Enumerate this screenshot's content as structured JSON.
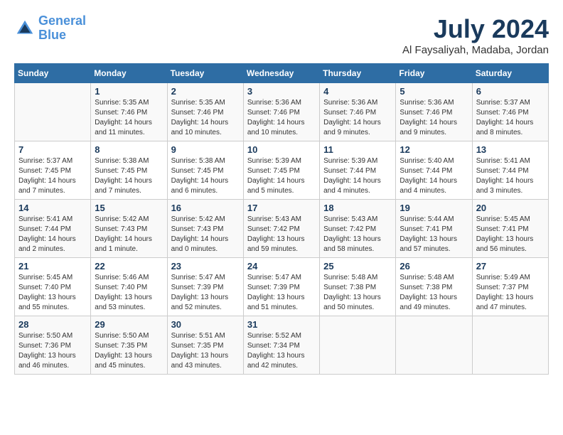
{
  "header": {
    "logo_line1": "General",
    "logo_line2": "Blue",
    "month_title": "July 2024",
    "location": "Al Faysaliyah, Madaba, Jordan"
  },
  "days_of_week": [
    "Sunday",
    "Monday",
    "Tuesday",
    "Wednesday",
    "Thursday",
    "Friday",
    "Saturday"
  ],
  "weeks": [
    [
      {
        "day": "",
        "info": ""
      },
      {
        "day": "1",
        "info": "Sunrise: 5:35 AM\nSunset: 7:46 PM\nDaylight: 14 hours\nand 11 minutes."
      },
      {
        "day": "2",
        "info": "Sunrise: 5:35 AM\nSunset: 7:46 PM\nDaylight: 14 hours\nand 10 minutes."
      },
      {
        "day": "3",
        "info": "Sunrise: 5:36 AM\nSunset: 7:46 PM\nDaylight: 14 hours\nand 10 minutes."
      },
      {
        "day": "4",
        "info": "Sunrise: 5:36 AM\nSunset: 7:46 PM\nDaylight: 14 hours\nand 9 minutes."
      },
      {
        "day": "5",
        "info": "Sunrise: 5:36 AM\nSunset: 7:46 PM\nDaylight: 14 hours\nand 9 minutes."
      },
      {
        "day": "6",
        "info": "Sunrise: 5:37 AM\nSunset: 7:46 PM\nDaylight: 14 hours\nand 8 minutes."
      }
    ],
    [
      {
        "day": "7",
        "info": "Sunrise: 5:37 AM\nSunset: 7:45 PM\nDaylight: 14 hours\nand 7 minutes."
      },
      {
        "day": "8",
        "info": "Sunrise: 5:38 AM\nSunset: 7:45 PM\nDaylight: 14 hours\nand 7 minutes."
      },
      {
        "day": "9",
        "info": "Sunrise: 5:38 AM\nSunset: 7:45 PM\nDaylight: 14 hours\nand 6 minutes."
      },
      {
        "day": "10",
        "info": "Sunrise: 5:39 AM\nSunset: 7:45 PM\nDaylight: 14 hours\nand 5 minutes."
      },
      {
        "day": "11",
        "info": "Sunrise: 5:39 AM\nSunset: 7:44 PM\nDaylight: 14 hours\nand 4 minutes."
      },
      {
        "day": "12",
        "info": "Sunrise: 5:40 AM\nSunset: 7:44 PM\nDaylight: 14 hours\nand 4 minutes."
      },
      {
        "day": "13",
        "info": "Sunrise: 5:41 AM\nSunset: 7:44 PM\nDaylight: 14 hours\nand 3 minutes."
      }
    ],
    [
      {
        "day": "14",
        "info": "Sunrise: 5:41 AM\nSunset: 7:44 PM\nDaylight: 14 hours\nand 2 minutes."
      },
      {
        "day": "15",
        "info": "Sunrise: 5:42 AM\nSunset: 7:43 PM\nDaylight: 14 hours\nand 1 minute."
      },
      {
        "day": "16",
        "info": "Sunrise: 5:42 AM\nSunset: 7:43 PM\nDaylight: 14 hours\nand 0 minutes."
      },
      {
        "day": "17",
        "info": "Sunrise: 5:43 AM\nSunset: 7:42 PM\nDaylight: 13 hours\nand 59 minutes."
      },
      {
        "day": "18",
        "info": "Sunrise: 5:43 AM\nSunset: 7:42 PM\nDaylight: 13 hours\nand 58 minutes."
      },
      {
        "day": "19",
        "info": "Sunrise: 5:44 AM\nSunset: 7:41 PM\nDaylight: 13 hours\nand 57 minutes."
      },
      {
        "day": "20",
        "info": "Sunrise: 5:45 AM\nSunset: 7:41 PM\nDaylight: 13 hours\nand 56 minutes."
      }
    ],
    [
      {
        "day": "21",
        "info": "Sunrise: 5:45 AM\nSunset: 7:40 PM\nDaylight: 13 hours\nand 55 minutes."
      },
      {
        "day": "22",
        "info": "Sunrise: 5:46 AM\nSunset: 7:40 PM\nDaylight: 13 hours\nand 53 minutes."
      },
      {
        "day": "23",
        "info": "Sunrise: 5:47 AM\nSunset: 7:39 PM\nDaylight: 13 hours\nand 52 minutes."
      },
      {
        "day": "24",
        "info": "Sunrise: 5:47 AM\nSunset: 7:39 PM\nDaylight: 13 hours\nand 51 minutes."
      },
      {
        "day": "25",
        "info": "Sunrise: 5:48 AM\nSunset: 7:38 PM\nDaylight: 13 hours\nand 50 minutes."
      },
      {
        "day": "26",
        "info": "Sunrise: 5:48 AM\nSunset: 7:38 PM\nDaylight: 13 hours\nand 49 minutes."
      },
      {
        "day": "27",
        "info": "Sunrise: 5:49 AM\nSunset: 7:37 PM\nDaylight: 13 hours\nand 47 minutes."
      }
    ],
    [
      {
        "day": "28",
        "info": "Sunrise: 5:50 AM\nSunset: 7:36 PM\nDaylight: 13 hours\nand 46 minutes."
      },
      {
        "day": "29",
        "info": "Sunrise: 5:50 AM\nSunset: 7:35 PM\nDaylight: 13 hours\nand 45 minutes."
      },
      {
        "day": "30",
        "info": "Sunrise: 5:51 AM\nSunset: 7:35 PM\nDaylight: 13 hours\nand 43 minutes."
      },
      {
        "day": "31",
        "info": "Sunrise: 5:52 AM\nSunset: 7:34 PM\nDaylight: 13 hours\nand 42 minutes."
      },
      {
        "day": "",
        "info": ""
      },
      {
        "day": "",
        "info": ""
      },
      {
        "day": "",
        "info": ""
      }
    ]
  ]
}
